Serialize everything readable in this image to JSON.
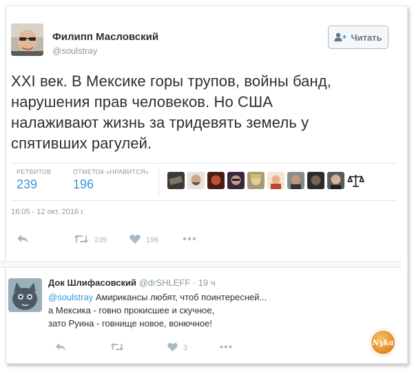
{
  "author": {
    "display_name": "Филипп Масловский",
    "username": "@soulstray"
  },
  "follow_button": {
    "label": "Читать"
  },
  "tweet": {
    "lines": [
      "XXI век. В Мексике горы трупов, войны банд,",
      "нарушения прав человеков. Но США",
      "налаживают жизнь за тридевять земель у",
      "спятивших рагулей."
    ],
    "timestamp": "16:05 - 12 окт. 2016 г."
  },
  "stats": {
    "retweets_label": "РЕТВИТОВ",
    "retweets_value": "239",
    "likes_label": "ОТМЕТОК «НРАВИТСЯ»",
    "likes_value": "196"
  },
  "liker_avatars": [
    "dark-photo",
    "beard-face",
    "red-face",
    "purple-face",
    "blonde-face",
    "cartoon-face",
    "man-face",
    "dark-face",
    "bald-face",
    "scales-icon"
  ],
  "actions": {
    "retweet_count": "239",
    "like_count": "196"
  },
  "reply": {
    "display_name": "Док Шлифасовский",
    "username": "@drSHLEFF",
    "separator": "·",
    "time": "19 ч",
    "mention": "@soulstray",
    "line1_rest": " Амириканcы любят, чтоб поинтересней...",
    "line2": "а Мексика - говно прокисшее и скучное,",
    "line3": "зато Руина - говнище новое, вонючное!",
    "like_count": "3"
  },
  "watermark": {
    "text": "Nyka"
  },
  "colors": {
    "link": "#3b94d9",
    "muted": "#8899a6",
    "icon": "#aab8c2"
  }
}
